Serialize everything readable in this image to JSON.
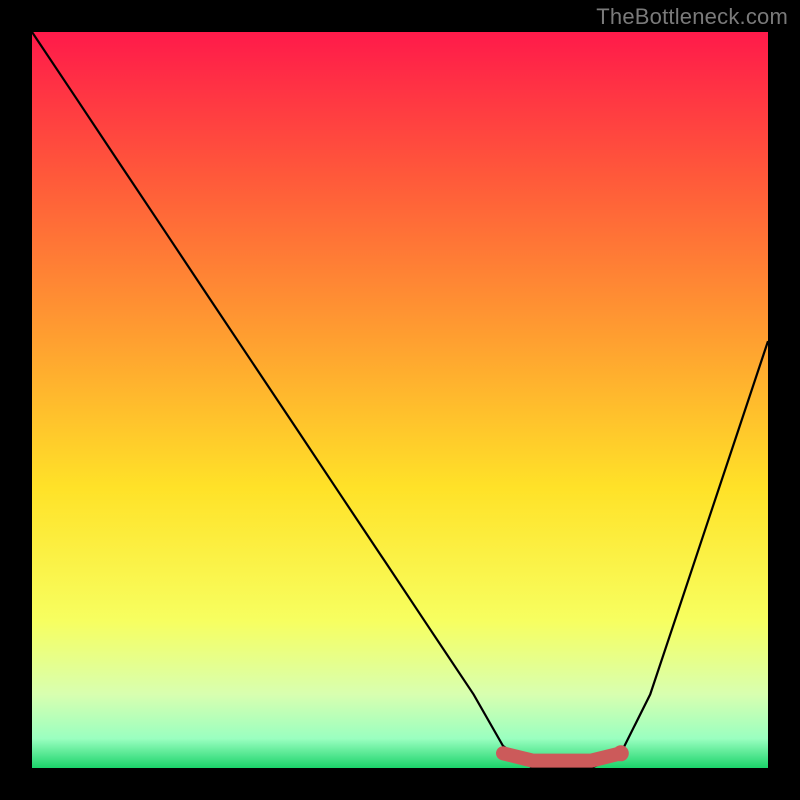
{
  "watermark": "TheBottleneck.com",
  "chart_data": {
    "type": "line",
    "title": "",
    "xlabel": "",
    "ylabel": "",
    "xlim": [
      0,
      100
    ],
    "ylim": [
      0,
      100
    ],
    "series": [
      {
        "name": "bottleneck-curve",
        "x": [
          0,
          6,
          12,
          18,
          24,
          30,
          36,
          42,
          48,
          54,
          60,
          64,
          68,
          72,
          76,
          80,
          84,
          88,
          92,
          96,
          100
        ],
        "values": [
          100,
          91,
          82,
          73,
          64,
          55,
          46,
          37,
          28,
          19,
          10,
          3,
          0,
          0,
          0,
          2,
          10,
          22,
          34,
          46,
          58
        ]
      }
    ],
    "highlight_segment": {
      "name": "optimal-range",
      "x": [
        64,
        68,
        72,
        76,
        80
      ],
      "values": [
        2,
        1,
        1,
        1,
        2
      ]
    },
    "highlight_point": {
      "x": 80,
      "value": 2
    },
    "gradient_stops": [
      {
        "pos": 0.0,
        "color": "#ff1a4a"
      },
      {
        "pos": 0.2,
        "color": "#ff5a3a"
      },
      {
        "pos": 0.42,
        "color": "#ffa030"
      },
      {
        "pos": 0.62,
        "color": "#ffe228"
      },
      {
        "pos": 0.8,
        "color": "#f7ff60"
      },
      {
        "pos": 0.9,
        "color": "#d8ffb0"
      },
      {
        "pos": 0.96,
        "color": "#9affc0"
      },
      {
        "pos": 1.0,
        "color": "#1bd36a"
      }
    ]
  }
}
